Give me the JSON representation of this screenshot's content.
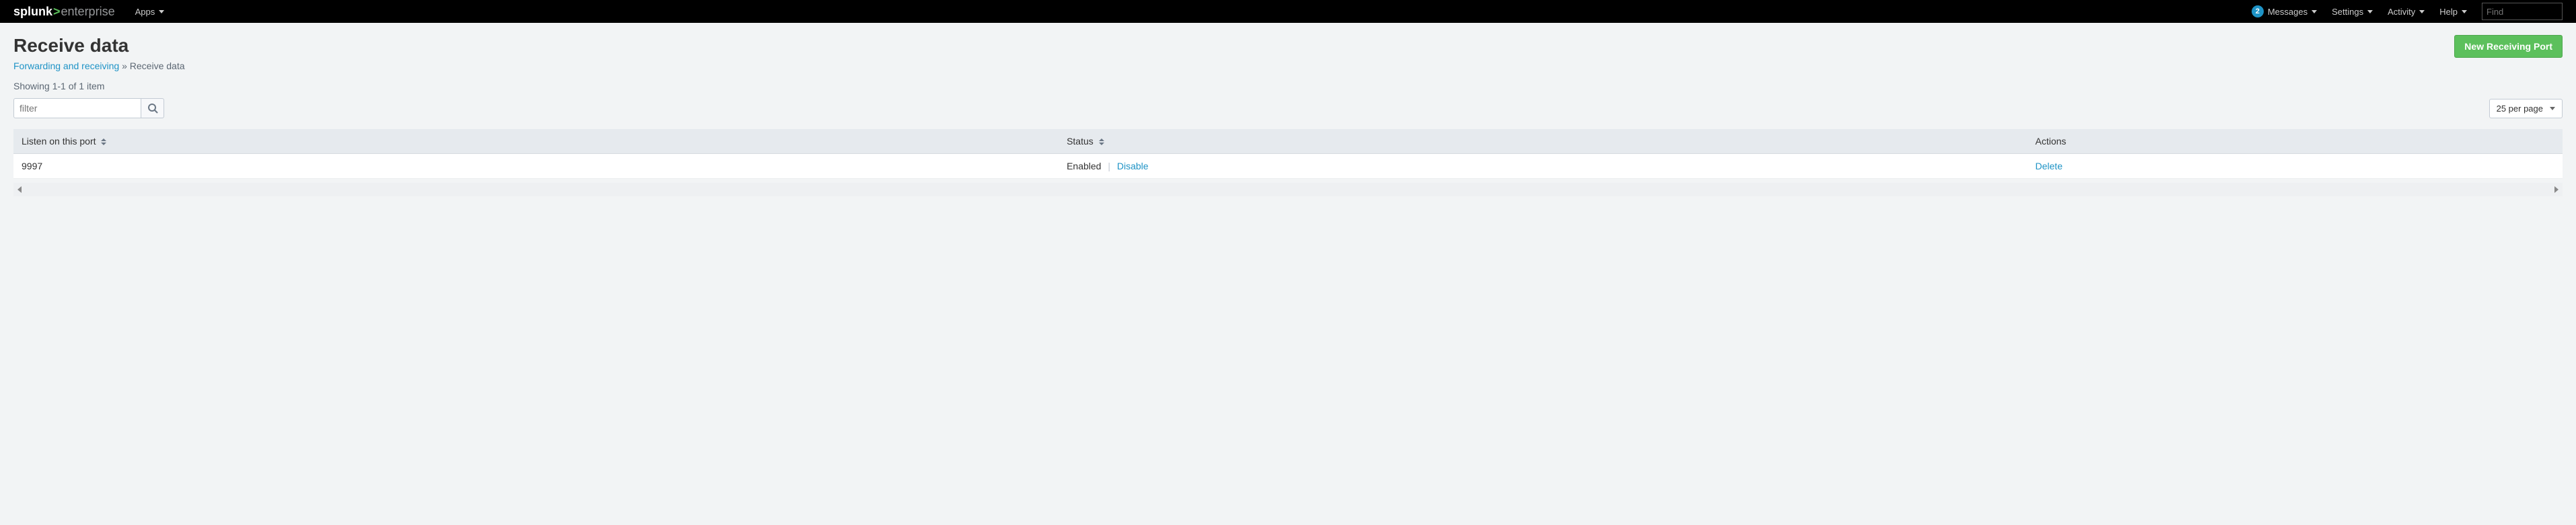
{
  "brand": {
    "part1": "splunk",
    "chevron": ">",
    "part2": "enterprise"
  },
  "topnav": {
    "apps_label": "Apps",
    "messages_badge": "2",
    "messages_label": "Messages",
    "settings_label": "Settings",
    "activity_label": "Activity",
    "help_label": "Help",
    "find_placeholder": "Find"
  },
  "page": {
    "title": "Receive data",
    "breadcrumb_link": "Forwarding and receiving",
    "breadcrumb_sep": " » ",
    "breadcrumb_current": "Receive data",
    "primary_button": "New Receiving Port",
    "showing": "Showing 1-1 of 1 item",
    "filter_placeholder": "filter",
    "per_page_label": "25 per page"
  },
  "table": {
    "headers": {
      "port": "Listen on this port",
      "status": "Status",
      "actions": "Actions"
    },
    "rows": [
      {
        "port": "9997",
        "status_text": "Enabled",
        "status_action": "Disable",
        "action": "Delete"
      }
    ]
  }
}
